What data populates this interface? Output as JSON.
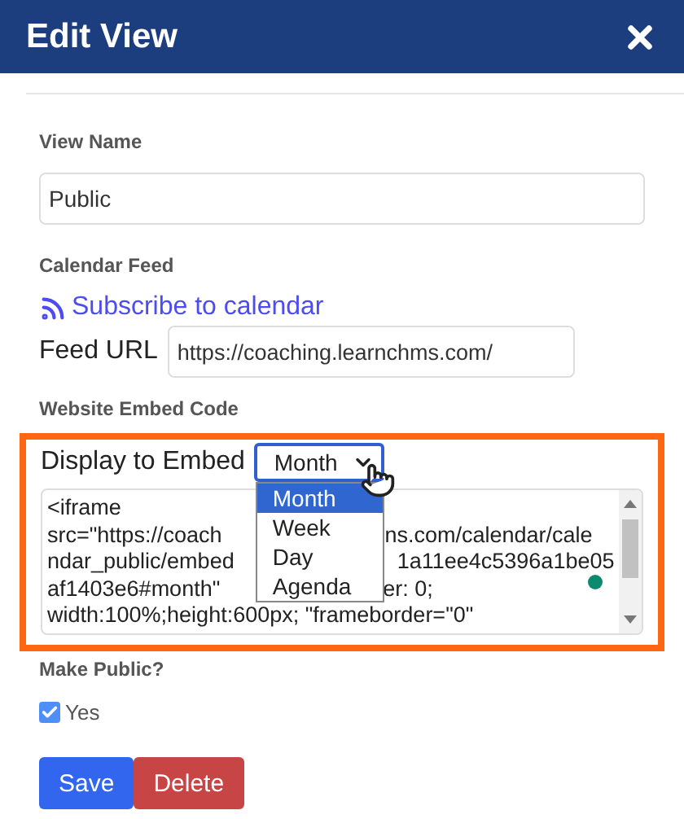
{
  "dialog": {
    "title": "Edit View"
  },
  "view_name": {
    "label": "View Name",
    "value": "Public"
  },
  "calendar_feed": {
    "label": "Calendar Feed",
    "link": "Subscribe to calendar",
    "url_label": "Feed URL",
    "url_value": "https://coaching.learnchms.com/"
  },
  "embed": {
    "label": "Website Embed Code",
    "display_label": "Display to Embed",
    "display_value": "Month",
    "options": [
      {
        "label": "Month",
        "selected": true
      },
      {
        "label": "Week",
        "selected": false
      },
      {
        "label": "Day",
        "selected": false
      },
      {
        "label": "Agenda",
        "selected": false
      }
    ],
    "code_lines": [
      {
        "left": "<iframe"
      },
      {
        "left": "src=\"https://coach",
        "right": "ns.com/calendar/cale"
      },
      {
        "left": "ndar_public/embed",
        "right": "1a11ee4c5396a1be05"
      },
      {
        "left": "af1403e6#month\"",
        "right": "er: 0;"
      },
      {
        "left": "width:100%;height:600px;  \"frameborder=\"0\""
      }
    ]
  },
  "make_public": {
    "label": "Make Public?",
    "option": "Yes",
    "checked": true
  },
  "buttons": [
    {
      "label": "Save",
      "kind": "primary"
    },
    {
      "label": "Delete",
      "kind": "danger"
    }
  ]
}
